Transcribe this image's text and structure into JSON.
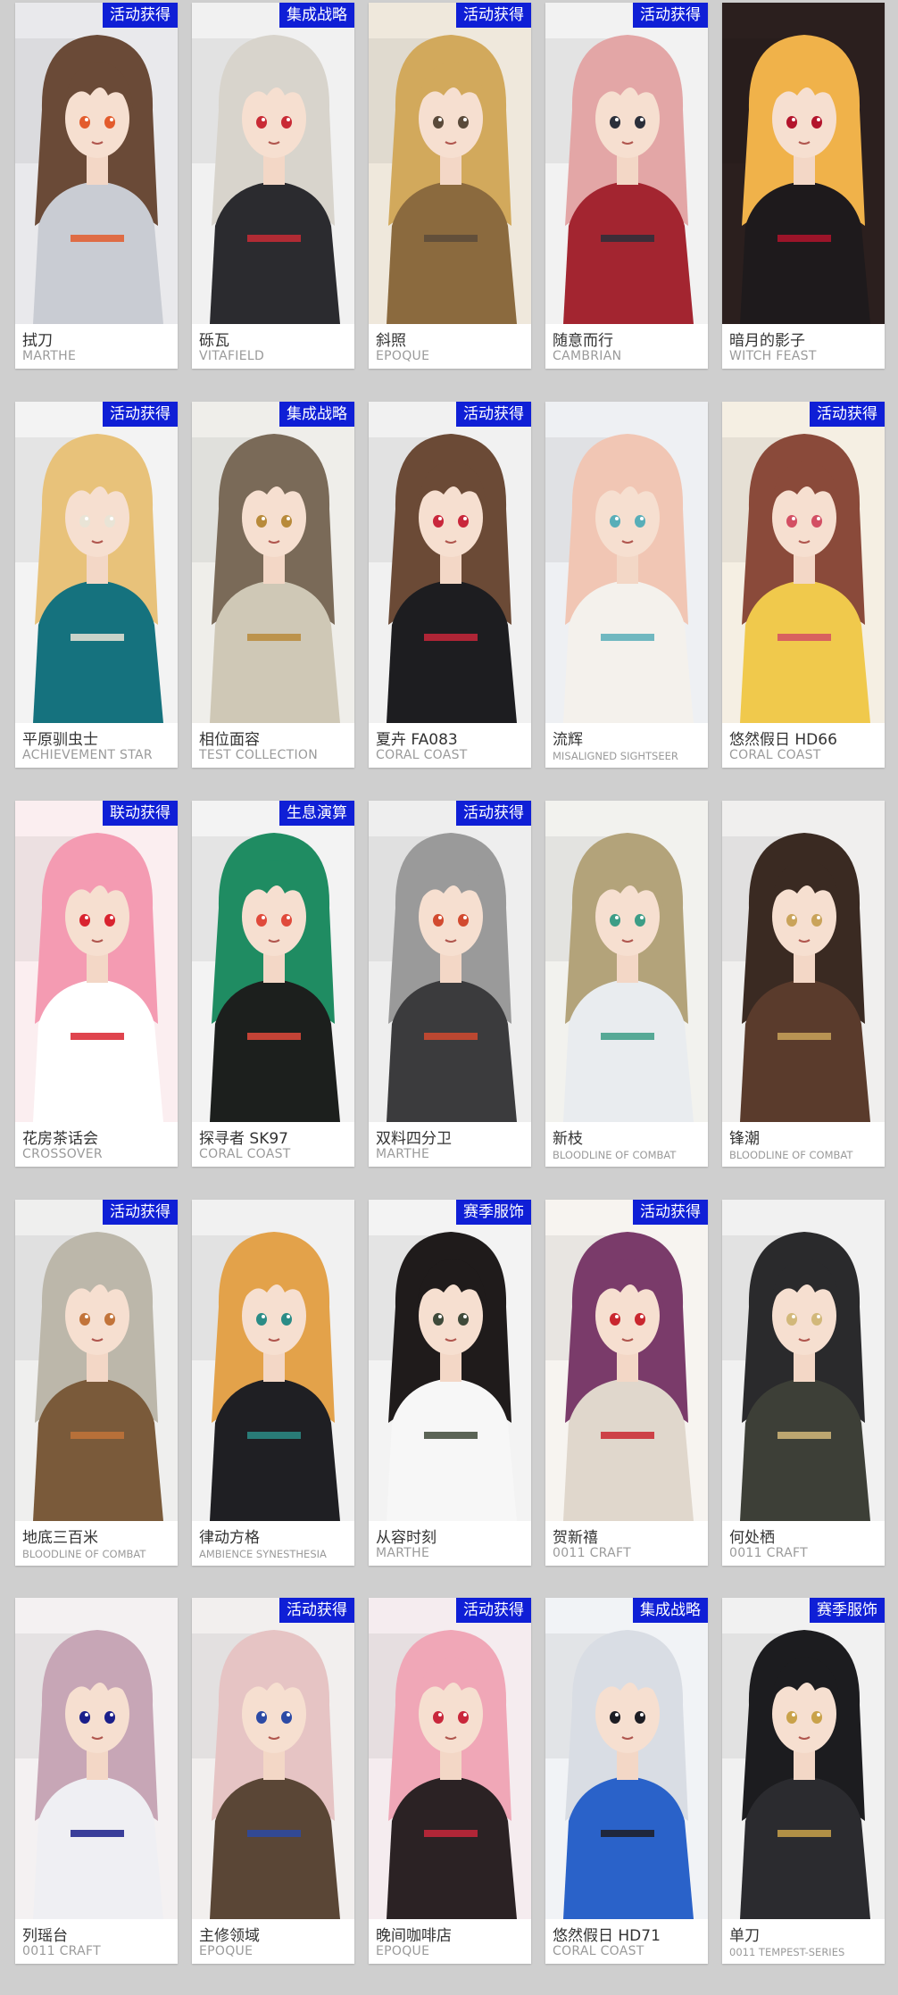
{
  "cards": [
    {
      "name": "拭刀",
      "theme": "MARTHE",
      "badge": "活动获得",
      "palette": {
        "bg": "#e9e9ec",
        "hair": "#6a4a37",
        "outfit": "#c9ccd3",
        "accent": "#e35b2c"
      }
    },
    {
      "name": "砾瓦",
      "theme": "VITAFIELD",
      "badge": "集成战略",
      "palette": {
        "bg": "#f1f1f1",
        "hair": "#d8d4cc",
        "outfit": "#2b2b2f",
        "accent": "#c92b35"
      }
    },
    {
      "name": "斜照",
      "theme": "EPOQUE",
      "badge": "活动获得",
      "palette": {
        "bg": "#efe8dc",
        "hair": "#d2a95c",
        "outfit": "#8b6a3e",
        "accent": "#5a4a3a"
      }
    },
    {
      "name": "随意而行",
      "theme": "CAMBRIAN",
      "badge": "活动获得",
      "palette": {
        "bg": "#f2f2f2",
        "hair": "#e3a6a6",
        "outfit": "#a32530",
        "accent": "#2b2f3a"
      }
    },
    {
      "name": "暗月的影子",
      "theme": "WITCH FEAST",
      "badge": "",
      "palette": {
        "bg": "#2b1f1e",
        "hair": "#f0b24a",
        "outfit": "#1e1a1c",
        "accent": "#b3142b"
      }
    },
    {
      "name": "平原驯虫士",
      "theme": "ACHIEVEMENT STAR",
      "badge": "活动获得",
      "palette": {
        "bg": "#f3f3f3",
        "hair": "#e8c27a",
        "outfit": "#15727e",
        "accent": "#e9e4d6"
      }
    },
    {
      "name": "相位面容",
      "theme": "TEST COLLECTION",
      "badge": "集成战略",
      "palette": {
        "bg": "#efeeea",
        "hair": "#7a6a58",
        "outfit": "#cfc8b6",
        "accent": "#b88a3a"
      }
    },
    {
      "name": "夏卉 FA083",
      "theme": "CORAL COAST",
      "badge": "活动获得",
      "palette": {
        "bg": "#f1f1f1",
        "hair": "#6b4a36",
        "outfit": "#1d1d20",
        "accent": "#c9273b"
      }
    },
    {
      "name": "流辉",
      "theme": "MISALIGNED SIGHTSEER",
      "badge": "",
      "palette": {
        "bg": "#eef0f3",
        "hair": "#f1c6b4",
        "outfit": "#f4f1ec",
        "accent": "#58aeb8"
      }
    },
    {
      "name": "悠然假日 HD66",
      "theme": "CORAL COAST",
      "badge": "活动获得",
      "palette": {
        "bg": "#f5efe3",
        "hair": "#8a4a3a",
        "outfit": "#f0c94c",
        "accent": "#d34f63"
      }
    },
    {
      "name": "花房茶话会",
      "theme": "CROSSOVER",
      "badge": "联动获得",
      "palette": {
        "bg": "#fbeef0",
        "hair": "#f49bb2",
        "outfit": "#ffffff",
        "accent": "#d9232f"
      }
    },
    {
      "name": "探寻者 SK97",
      "theme": "CORAL COAST",
      "badge": "生息演算",
      "palette": {
        "bg": "#f3f3f3",
        "hair": "#1f8c62",
        "outfit": "#1c1f1d",
        "accent": "#e04a3b"
      }
    },
    {
      "name": "双料四分卫",
      "theme": "MARTHE",
      "badge": "活动获得",
      "palette": {
        "bg": "#eeeeee",
        "hair": "#9a9a9a",
        "outfit": "#3b3b3d",
        "accent": "#d24a2f"
      }
    },
    {
      "name": "新枝",
      "theme": "BLOODLINE OF COMBAT",
      "badge": "",
      "palette": {
        "bg": "#f2f2ee",
        "hair": "#b3a37a",
        "outfit": "#e9ecef",
        "accent": "#3c9d86"
      }
    },
    {
      "name": "锋潮",
      "theme": "BLOODLINE OF COMBAT",
      "badge": "",
      "palette": {
        "bg": "#f0efee",
        "hair": "#3a2a22",
        "outfit": "#5a3b2c",
        "accent": "#c9a35a"
      }
    },
    {
      "name": "地底三百米",
      "theme": "BLOODLINE OF COMBAT",
      "badge": "活动获得",
      "palette": {
        "bg": "#efefee",
        "hair": "#bcb7aa",
        "outfit": "#7a5a3a",
        "accent": "#c2743a"
      }
    },
    {
      "name": "律动方格",
      "theme": "AMBIENCE SYNESTHESIA",
      "badge": "",
      "palette": {
        "bg": "#f1f1f1",
        "hair": "#e3a24a",
        "outfit": "#1f1f23",
        "accent": "#2b8c86"
      }
    },
    {
      "name": "从容时刻",
      "theme": "MARTHE",
      "badge": "赛季服饰",
      "palette": {
        "bg": "#f3f3f3",
        "hair": "#1f1b1b",
        "outfit": "#f7f7f7",
        "accent": "#3f4a3a"
      }
    },
    {
      "name": "贺新禧",
      "theme": "0011 CRAFT",
      "badge": "活动获得",
      "palette": {
        "bg": "#f7f4f0",
        "hair": "#7a3b6a",
        "outfit": "#e0d7cc",
        "accent": "#c9272f"
      }
    },
    {
      "name": "何处栖",
      "theme": "0011 CRAFT",
      "badge": "",
      "palette": {
        "bg": "#f1f1f1",
        "hair": "#2a2a2c",
        "outfit": "#3d3f37",
        "accent": "#d2b87a"
      }
    },
    {
      "name": "列瑶台",
      "theme": "0011 CRAFT",
      "badge": "",
      "palette": {
        "bg": "#f4f1f2",
        "hair": "#c7a6b6",
        "outfit": "#efeff3",
        "accent": "#1a1e8a"
      }
    },
    {
      "name": "主修领域",
      "theme": "EPOQUE",
      "badge": "活动获得",
      "palette": {
        "bg": "#f2efee",
        "hair": "#e6c4c4",
        "outfit": "#5a4636",
        "accent": "#2c4aa5"
      }
    },
    {
      "name": "晚间咖啡店",
      "theme": "EPOQUE",
      "badge": "活动获得",
      "palette": {
        "bg": "#f5ecef",
        "hair": "#f0a7b7",
        "outfit": "#2b2224",
        "accent": "#c9273b"
      }
    },
    {
      "name": "悠然假日 HD71",
      "theme": "CORAL COAST",
      "badge": "集成战略",
      "palette": {
        "bg": "#f1f3f6",
        "hair": "#d9dde4",
        "outfit": "#2a62c9",
        "accent": "#1d1d23"
      }
    },
    {
      "name": "单刀",
      "theme": "0011 TEMPEST-SERIES",
      "badge": "赛季服饰",
      "palette": {
        "bg": "#f1f1f1",
        "hair": "#1c1c1f",
        "outfit": "#2b2b2f",
        "accent": "#c9a24a"
      }
    }
  ]
}
